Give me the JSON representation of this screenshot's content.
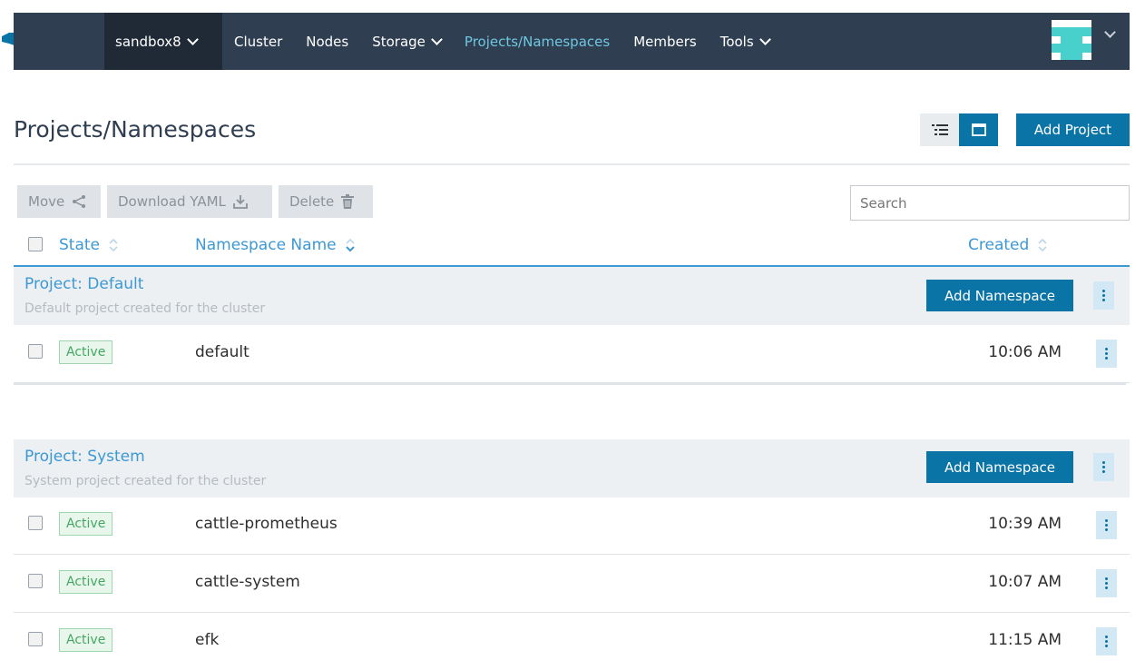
{
  "header": {
    "cluster": "sandbox8",
    "nav": [
      {
        "label": "Cluster",
        "dropdown": false,
        "active": false
      },
      {
        "label": "Nodes",
        "dropdown": false,
        "active": false
      },
      {
        "label": "Storage",
        "dropdown": true,
        "active": false
      },
      {
        "label": "Projects/Namespaces",
        "dropdown": false,
        "active": true
      },
      {
        "label": "Members",
        "dropdown": false,
        "active": false
      },
      {
        "label": "Tools",
        "dropdown": true,
        "active": false
      }
    ],
    "user_menu_icon": "chevron-down-icon"
  },
  "page": {
    "title": "Projects/Namespaces",
    "add_project": "Add Project",
    "view_modes": [
      "list-icon",
      "group-icon"
    ]
  },
  "toolbar": {
    "move": "Move",
    "download_yaml": "Download YAML",
    "delete": "Delete",
    "search_placeholder": "Search"
  },
  "table": {
    "columns": {
      "state": "State",
      "name": "Namespace Name",
      "created": "Created"
    }
  },
  "groups": [
    {
      "name": "Project: Default",
      "description": "Default project created for the cluster",
      "add_label": "Add Namespace",
      "rows": [
        {
          "state": "Active",
          "name": "default",
          "created": "10:06 AM"
        }
      ]
    },
    {
      "name": "Project: System",
      "description": "System project created for the cluster",
      "add_label": "Add Namespace",
      "rows": [
        {
          "state": "Active",
          "name": "cattle-prometheus",
          "created": "10:39 AM"
        },
        {
          "state": "Active",
          "name": "cattle-system",
          "created": "10:07 AM"
        },
        {
          "state": "Active",
          "name": "efk",
          "created": "11:15 AM"
        }
      ]
    }
  ],
  "colors": {
    "nav_bg": "#2f3e50",
    "accent": "#0a74a6",
    "link": "#3d98d3",
    "active_green": "#44a862"
  }
}
